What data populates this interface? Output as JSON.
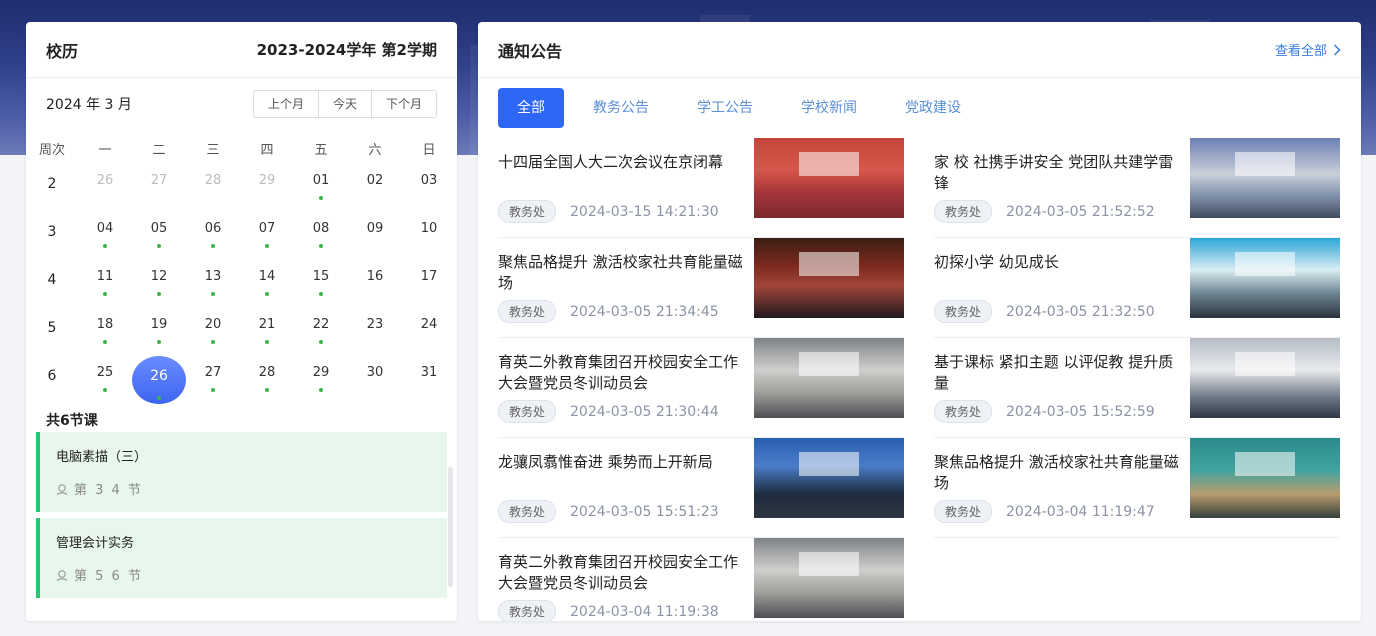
{
  "calendar": {
    "title": "校历",
    "term": "2023-2024学年 第2学期",
    "month": "2024 年 3 月",
    "buttons": {
      "prev": "上个月",
      "today": "今天",
      "next": "下个月"
    },
    "weekday_headers": [
      "周次",
      "一",
      "二",
      "三",
      "四",
      "五",
      "六",
      "日"
    ],
    "weeks": [
      {
        "no": "2",
        "days": [
          {
            "d": "26",
            "dim": true,
            "dot": false
          },
          {
            "d": "27",
            "dim": true,
            "dot": false
          },
          {
            "d": "28",
            "dim": true,
            "dot": false
          },
          {
            "d": "29",
            "dim": true,
            "dot": false
          },
          {
            "d": "01",
            "dim": false,
            "dot": true
          },
          {
            "d": "02",
            "dim": false,
            "dot": false
          },
          {
            "d": "03",
            "dim": false,
            "dot": false
          }
        ]
      },
      {
        "no": "3",
        "days": [
          {
            "d": "04",
            "dot": true
          },
          {
            "d": "05",
            "dot": true
          },
          {
            "d": "06",
            "dot": true
          },
          {
            "d": "07",
            "dot": true
          },
          {
            "d": "08",
            "dot": true
          },
          {
            "d": "09",
            "dot": false
          },
          {
            "d": "10",
            "dot": false
          }
        ]
      },
      {
        "no": "4",
        "days": [
          {
            "d": "11",
            "dot": true
          },
          {
            "d": "12",
            "dot": true
          },
          {
            "d": "13",
            "dot": true
          },
          {
            "d": "14",
            "dot": true
          },
          {
            "d": "15",
            "dot": true
          },
          {
            "d": "16",
            "dot": false
          },
          {
            "d": "17",
            "dot": false
          }
        ]
      },
      {
        "no": "5",
        "days": [
          {
            "d": "18",
            "dot": true
          },
          {
            "d": "19",
            "dot": true
          },
          {
            "d": "20",
            "dot": true
          },
          {
            "d": "21",
            "dot": true
          },
          {
            "d": "22",
            "dot": true
          },
          {
            "d": "23",
            "dot": false
          },
          {
            "d": "24",
            "dot": false
          }
        ]
      },
      {
        "no": "6",
        "days": [
          {
            "d": "25",
            "dot": true
          },
          {
            "d": "26",
            "dot": true,
            "selected": true
          },
          {
            "d": "27",
            "dot": true
          },
          {
            "d": "28",
            "dot": true
          },
          {
            "d": "29",
            "dot": true
          },
          {
            "d": "30",
            "dot": false
          },
          {
            "d": "31",
            "dot": false
          }
        ]
      }
    ],
    "course_count": "共6节课",
    "courses": [
      {
        "name": "电脑素描（三）",
        "section": "第 3 4 节"
      },
      {
        "name": "管理会计实务",
        "section": "第 5 6 节"
      }
    ]
  },
  "news": {
    "title": "通知公告",
    "view_all": "查看全部",
    "tabs": [
      "全部",
      "教务公告",
      "学工公告",
      "学校新闻",
      "党政建设"
    ],
    "left": [
      {
        "title": "十四届全国人大二次会议在京闭幕",
        "tag": "教务处",
        "date": "2024-03-15 14:21:30",
        "thumb": "t1"
      },
      {
        "title": "聚焦品格提升 激活校家社共育能量磁场",
        "tag": "教务处",
        "date": "2024-03-05 21:34:45",
        "thumb": "t2"
      },
      {
        "title": "育英二外教育集团召开校园安全工作大会暨党员冬训动员会",
        "tag": "教务处",
        "date": "2024-03-05 21:30:44",
        "thumb": "t3"
      },
      {
        "title": "龙骧凤翥惟奋进 乘势而上开新局",
        "tag": "教务处",
        "date": "2024-03-05 15:51:23",
        "thumb": "t5"
      },
      {
        "title": "育英二外教育集团召开校园安全工作大会暨党员冬训动员会",
        "tag": "教务处",
        "date": "2024-03-04 11:19:38",
        "thumb": "t3"
      }
    ],
    "right": [
      {
        "title": "家 校 社携手讲安全 党团队共建学雷锋",
        "tag": "教务处",
        "date": "2024-03-05 21:52:52",
        "thumb": "t6"
      },
      {
        "title": "初探小学 幼见成长",
        "tag": "教务处",
        "date": "2024-03-05 21:32:50",
        "thumb": "t4"
      },
      {
        "title": "基于课标 紧扣主题 以评促教 提升质量",
        "tag": "教务处",
        "date": "2024-03-05 15:52:59",
        "thumb": "t7"
      },
      {
        "title": "聚焦品格提升 激活校家社共育能量磁场",
        "tag": "教务处",
        "date": "2024-03-04 11:19:47",
        "thumb": "t8"
      }
    ]
  }
}
